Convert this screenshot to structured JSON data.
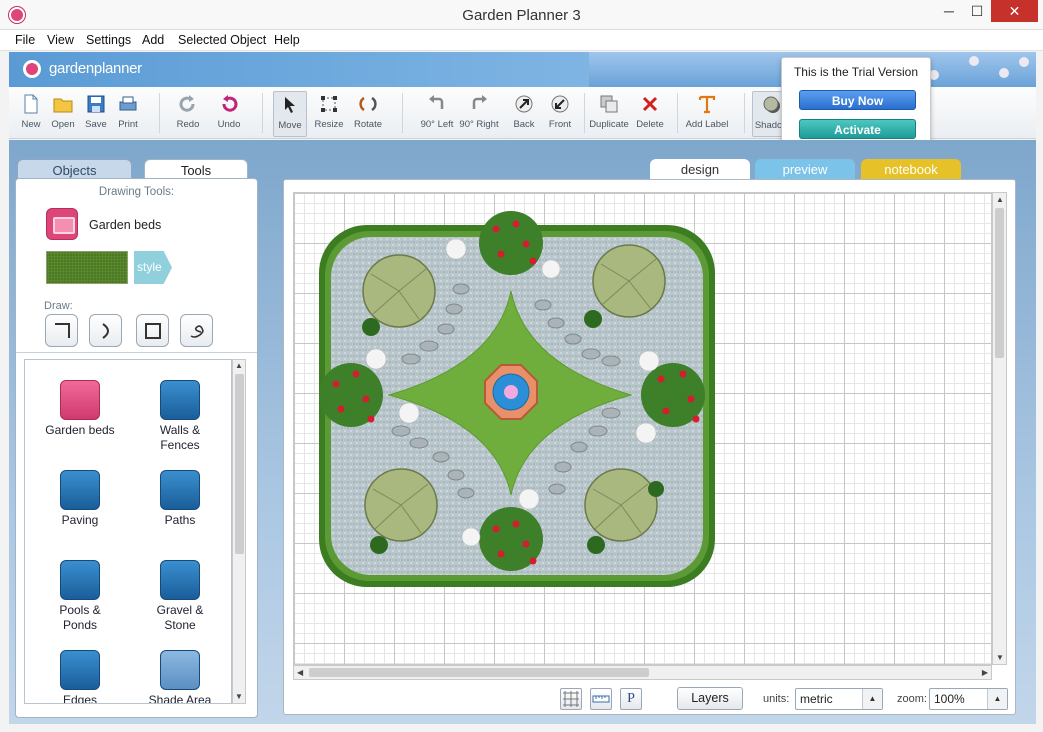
{
  "window": {
    "title": "Garden Planner 3",
    "min": "─",
    "max": "☐",
    "close": "✕"
  },
  "menu": [
    "File",
    "View",
    "Settings",
    "Add",
    "Selected Object",
    "Help"
  ],
  "banner": {
    "logo_text": "gardenplanner"
  },
  "toolbar": {
    "new": "New",
    "open": "Open",
    "save": "Save",
    "print": "Print",
    "redo": "Redo",
    "undo": "Undo",
    "move": "Move",
    "resize": "Resize",
    "rotate": "Rotate",
    "rot_left": "90° Left",
    "rot_right": "90° Right",
    "back": "Back",
    "front": "Front",
    "duplicate": "Duplicate",
    "delete": "Delete",
    "add_label": "Add Label",
    "shadow": "Shadow"
  },
  "trial": {
    "text": "This is the Trial Version",
    "buy": "Buy Now",
    "activate": "Activate"
  },
  "left_tabs": {
    "objects": "Objects",
    "tools": "Tools"
  },
  "drawing": {
    "title": "Drawing Tools:",
    "selected_tool": "Garden beds",
    "style_btn": "style",
    "draw_label": "Draw:"
  },
  "categories": [
    {
      "label": "Garden beds"
    },
    {
      "label": "Walls & Fences"
    },
    {
      "label": "Paving"
    },
    {
      "label": "Paths"
    },
    {
      "label": "Pools & Ponds"
    },
    {
      "label": "Gravel & Stone"
    },
    {
      "label": "Edges"
    },
    {
      "label": "Shade Area"
    }
  ],
  "view_tabs": {
    "design": "design",
    "preview": "preview",
    "notebook": "notebook"
  },
  "bottom": {
    "layers": "Layers",
    "units_label": "units:",
    "units_value": "metric",
    "zoom_label": "zoom:",
    "zoom_value": "100%",
    "p_btn": "P"
  },
  "colors": {
    "accent_pink": "#e0457a",
    "lawn": "#6fae3c",
    "hedge": "#3d7d22",
    "gravel": "#b9c7cc",
    "preview_tab": "#7cc3ea",
    "notebook_tab": "#e6c127"
  }
}
